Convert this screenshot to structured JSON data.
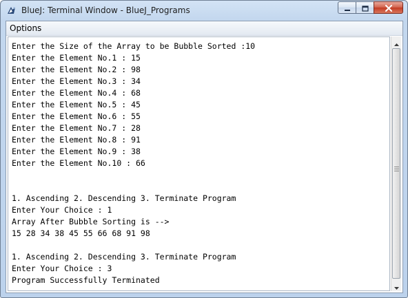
{
  "window": {
    "title": "BlueJ: Terminal Window - BlueJ_Programs",
    "controls": [
      "minimize",
      "maximize",
      "close"
    ]
  },
  "menubar": {
    "items": [
      {
        "label": "Options"
      }
    ]
  },
  "terminal": {
    "lines": [
      "Enter the Size of the Array to be Bubble Sorted :10",
      "Enter the Element No.1 : 15",
      "Enter the Element No.2 : 98",
      "Enter the Element No.3 : 34",
      "Enter the Element No.4 : 68",
      "Enter the Element No.5 : 45",
      "Enter the Element No.6 : 55",
      "Enter the Element No.7 : 28",
      "Enter the Element No.8 : 91",
      "Enter the Element No.9 : 38",
      "Enter the Element No.10 : 66",
      "",
      "",
      "1. Ascending 2. Descending 3. Terminate Program",
      "Enter Your Choice : 1",
      "Array After Bubble Sorting is -->",
      "15 28 34 38 45 55 66 68 91 98",
      "",
      "1. Ascending 2. Descending 3. Terminate Program",
      "Enter Your Choice : 3",
      "Program Successfully Terminated"
    ]
  },
  "icons": {
    "app": "bluej-icon",
    "minimize": "minimize-icon",
    "maximize": "maximize-icon",
    "close": "close-icon",
    "scroll_up": "scroll-up-arrow-icon",
    "scroll_down": "scroll-down-arrow-icon"
  },
  "colors": {
    "titlebar": "#c3d7ee",
    "close_button": "#c23c24",
    "terminal_bg": "#ffffff",
    "text": "#000000"
  }
}
